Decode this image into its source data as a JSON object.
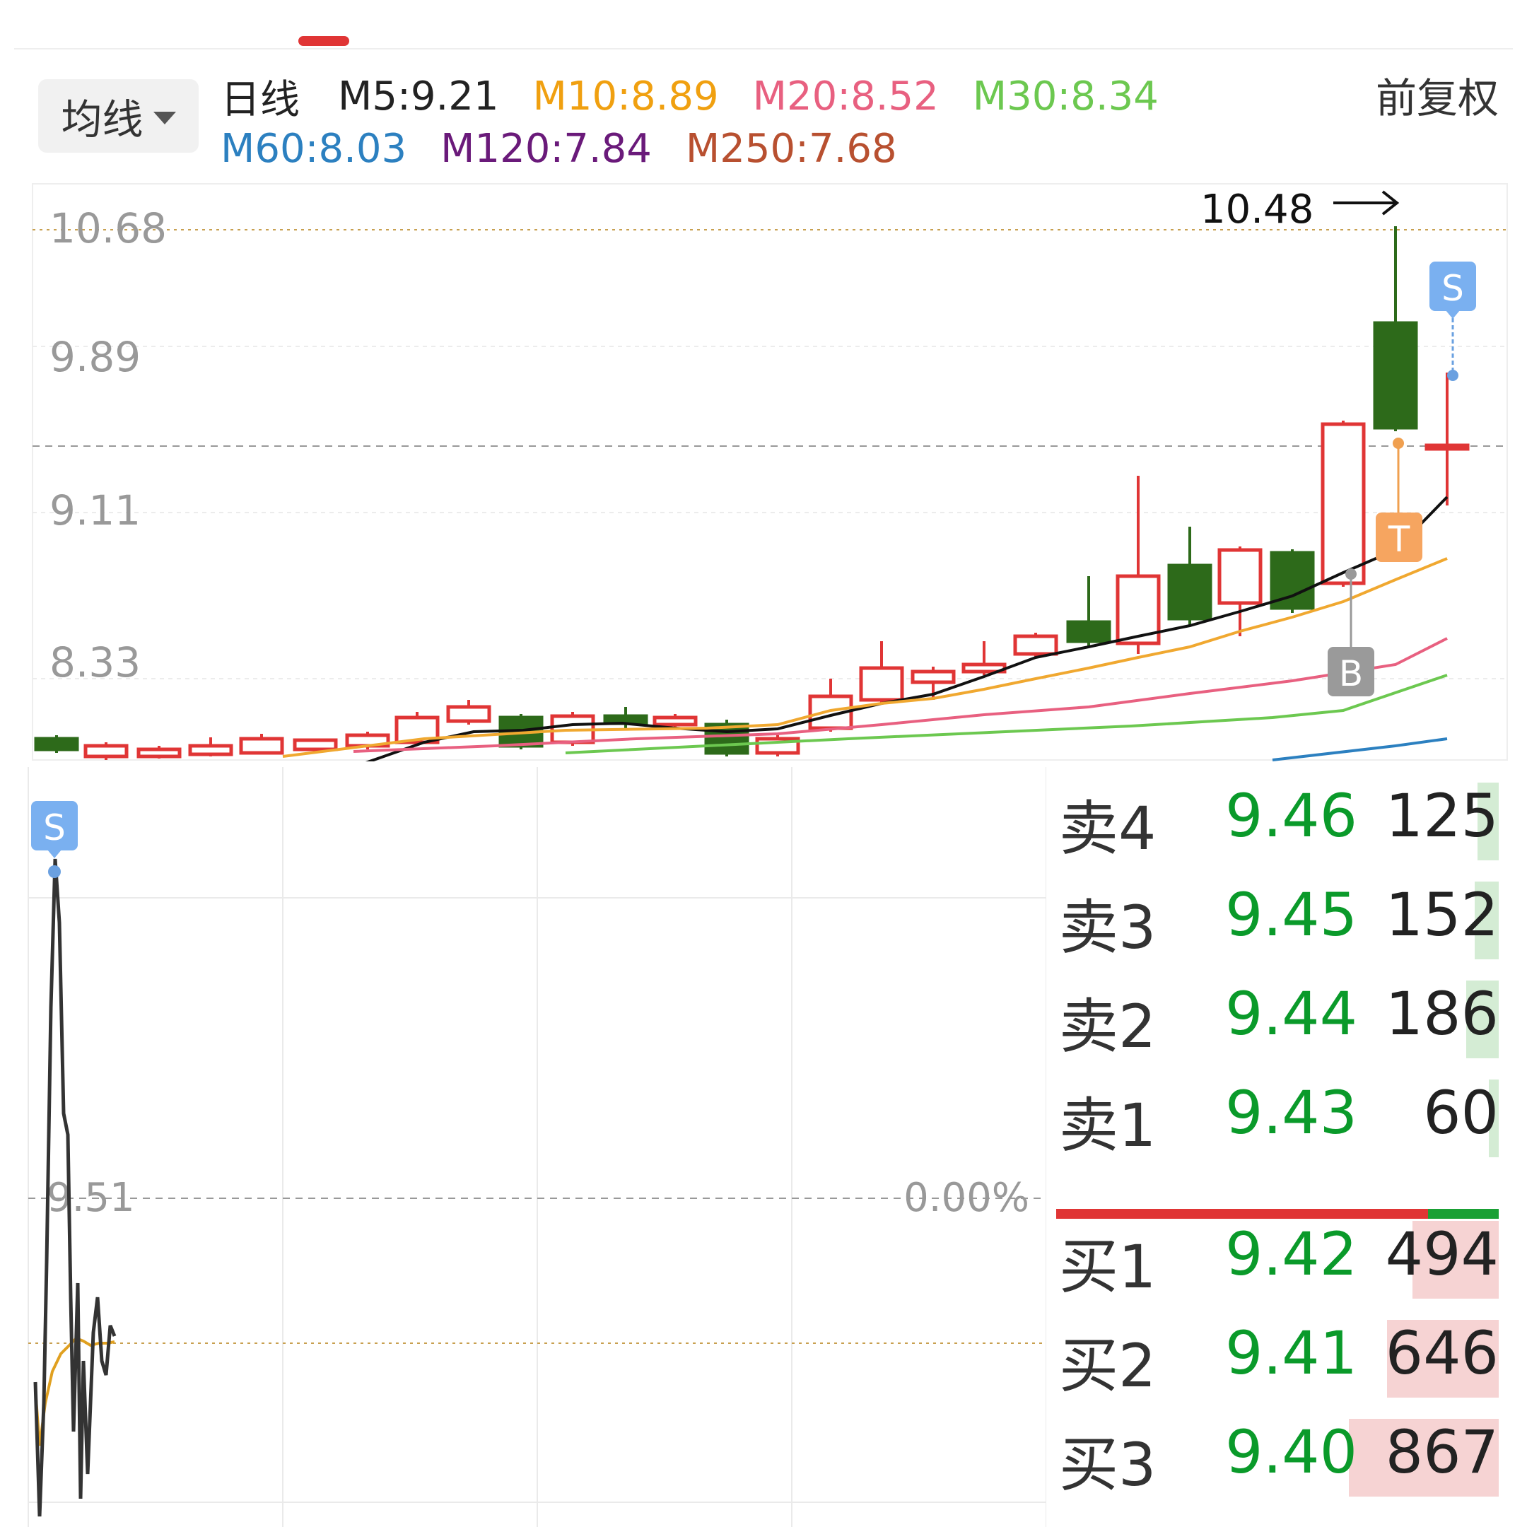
{
  "tabs": {
    "active_indicator_color": "#e03535"
  },
  "header": {
    "ma_dropdown_label": "均线",
    "period_label": "日线",
    "adjust_label": "前复权",
    "ma_values": [
      {
        "label": "M5:9.21",
        "color": "#222222"
      },
      {
        "label": "M10:8.89",
        "color": "#f0a010"
      },
      {
        "label": "M20:8.52",
        "color": "#e86080"
      },
      {
        "label": "M30:8.34",
        "color": "#6cc850"
      },
      {
        "label": "M60:8.03",
        "color": "#2c80c0"
      },
      {
        "label": "M120:7.84",
        "color": "#6a1a7a"
      },
      {
        "label": "M250:7.68",
        "color": "#b85030"
      }
    ]
  },
  "kline": {
    "y_labels": [
      "10.68",
      "9.89",
      "9.11",
      "8.33"
    ],
    "high_marker": "10.48",
    "signals": {
      "sell": "S",
      "buy": "B",
      "t": "T"
    },
    "colors": {
      "up": "#e03535",
      "down": "#2d6a1a",
      "m5": "#111111",
      "m10": "#f0a830",
      "m20": "#e86080",
      "m30": "#6cc850",
      "m60": "#2c80c0"
    }
  },
  "intraday": {
    "sell_signal": "S",
    "price_label": "9.51",
    "pct_label": "0.00%"
  },
  "orderbook": {
    "asks": [
      {
        "label": "卖4",
        "price": "9.46",
        "volume": "125"
      },
      {
        "label": "卖3",
        "price": "9.45",
        "volume": "152"
      },
      {
        "label": "卖2",
        "price": "9.44",
        "volume": "186"
      },
      {
        "label": "卖1",
        "price": "9.43",
        "volume": "60"
      }
    ],
    "bids": [
      {
        "label": "买1",
        "price": "9.42",
        "volume": "494"
      },
      {
        "label": "买2",
        "price": "9.41",
        "volume": "646"
      },
      {
        "label": "买3",
        "price": "9.40",
        "volume": "867"
      }
    ],
    "buy_sell_ratio": 0.84,
    "colors": {
      "price": "#0a9a2a",
      "ask_bar": "#d4ecd4",
      "bid_bar": "#f6d3d3",
      "buy": "#e03535",
      "sell": "#1aa035"
    }
  }
}
